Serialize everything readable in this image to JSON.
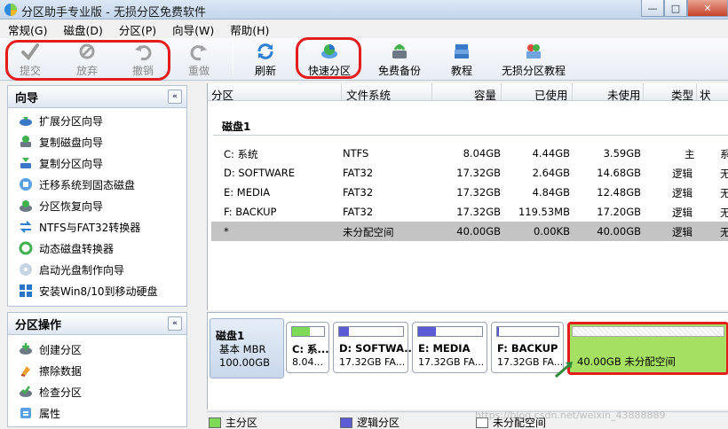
{
  "window": {
    "title": "分区助手专业版 - 无损分区免费软件",
    "minimize": "—",
    "maximize": "□",
    "close": "✕"
  },
  "menu": [
    {
      "label": "常规(G)"
    },
    {
      "label": "磁盘(D)"
    },
    {
      "label": "分区(P)"
    },
    {
      "label": "向导(W)"
    },
    {
      "label": "帮助(H)"
    }
  ],
  "toolbar": {
    "submit": "提交",
    "discard": "放弃",
    "undo": "撤销",
    "redo": "重做",
    "refresh": "刷新",
    "quick_partition": "快速分区",
    "free_backup": "免费备份",
    "tutorial": "教程",
    "lossless_tutorial": "无损分区教程"
  },
  "wizard_panel": {
    "title": "向导",
    "collapse": "«",
    "items": [
      {
        "label": "扩展分区向导"
      },
      {
        "label": "复制磁盘向导"
      },
      {
        "label": "复制分区向导"
      },
      {
        "label": "迁移系统到固态磁盘"
      },
      {
        "label": "分区恢复向导"
      },
      {
        "label": "NTFS与FAT32转换器"
      },
      {
        "label": "动态磁盘转换器"
      },
      {
        "label": "启动光盘制作向导"
      },
      {
        "label": "安装Win8/10到移动硬盘"
      }
    ]
  },
  "ops_panel": {
    "title": "分区操作",
    "collapse": "«",
    "items": [
      {
        "label": "创建分区"
      },
      {
        "label": "擦除数据"
      },
      {
        "label": "检查分区"
      },
      {
        "label": "属性"
      }
    ]
  },
  "table": {
    "columns": [
      "分区",
      "文件系统",
      "容量",
      "已使用",
      "未使用",
      "类型",
      "状"
    ],
    "disk_label": "磁盘1",
    "rows": [
      {
        "name": "C: 系统",
        "fs": "NTFS",
        "capacity": "8.04GB",
        "used": "4.44GB",
        "free": "3.59GB",
        "type": "主",
        "status": "系"
      },
      {
        "name": "D: SOFTWARE",
        "fs": "FAT32",
        "capacity": "17.32GB",
        "used": "2.64GB",
        "free": "14.68GB",
        "type": "逻辑",
        "status": "无"
      },
      {
        "name": "E: MEDIA",
        "fs": "FAT32",
        "capacity": "17.32GB",
        "used": "4.84GB",
        "free": "12.48GB",
        "type": "逻辑",
        "status": "无"
      },
      {
        "name": "F: BACKUP",
        "fs": "FAT32",
        "capacity": "17.32GB",
        "used": "119.53MB",
        "free": "17.20GB",
        "type": "逻辑",
        "status": "无"
      },
      {
        "name": "*",
        "fs": "未分配空间",
        "capacity": "40.00GB",
        "used": "0.00KB",
        "free": "40.00GB",
        "type": "逻辑",
        "status": "无"
      }
    ]
  },
  "disk_map": {
    "name": "磁盘1",
    "type": "基本 MBR",
    "size": "100.00GB",
    "partitions": [
      {
        "name": "C: 系...",
        "info": "8.04...",
        "bar_color": "#7ed957",
        "used_fraction": 0.55
      },
      {
        "name": "D: SOFTWA...",
        "info": "17.32GB FA...",
        "bar_color": "#5b5bd6",
        "used_fraction": 0.15
      },
      {
        "name": "E: MEDIA",
        "info": "17.32GB FA...",
        "bar_color": "#5b5bd6",
        "used_fraction": 0.28
      },
      {
        "name": "F: BACKUP",
        "info": "17.32GB FA...",
        "bar_color": "#5b5bd6",
        "used_fraction": 0.02
      }
    ],
    "unallocated": {
      "info": "40.00GB 未分配空间"
    }
  },
  "legend": [
    {
      "label": "主分区",
      "color": "#7ed957"
    },
    {
      "label": "逻辑分区",
      "color": "#5b5bd6"
    },
    {
      "label": "未分配空间",
      "color": "#ffffff"
    }
  ],
  "watermark": "https://blog.csdn.net/weixin_43888889"
}
